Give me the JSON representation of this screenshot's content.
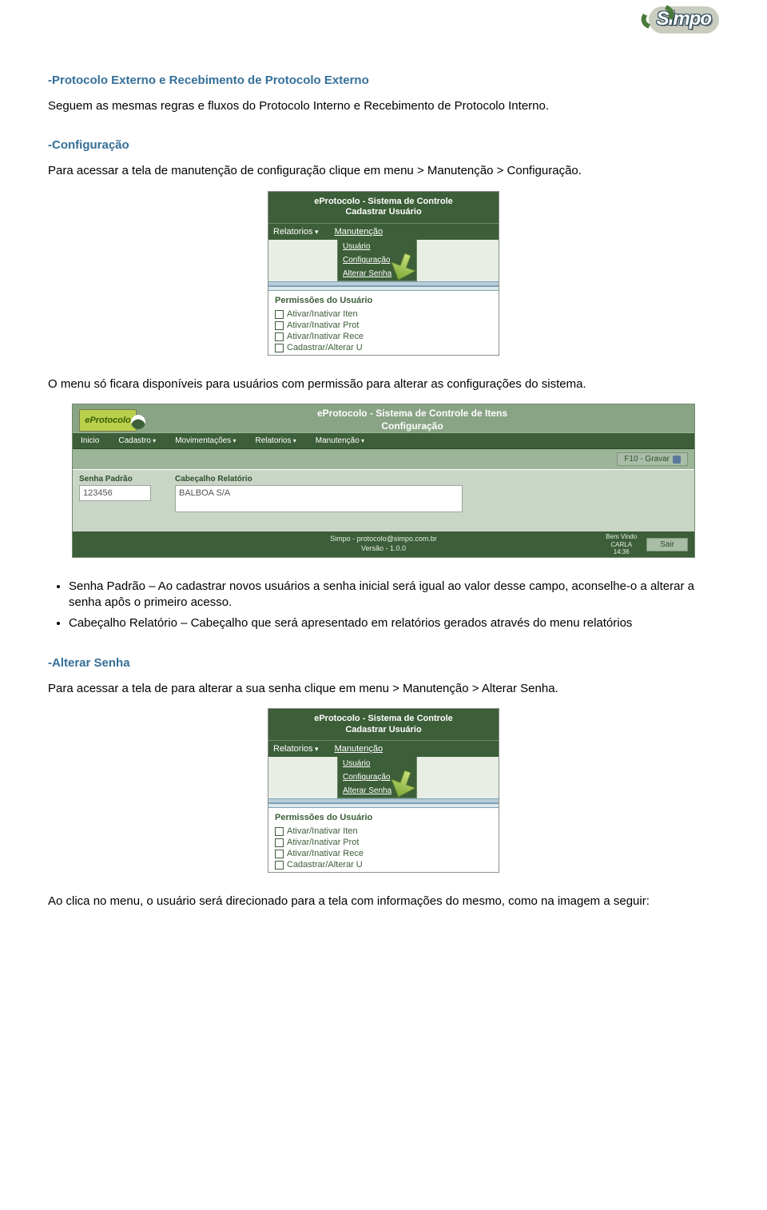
{
  "logo_text": "Simpo",
  "sections": {
    "s1_title": "-Protocolo Externo e Recebimento de Protocolo Externo",
    "s1_p1": "Seguem as mesmas regras e fluxos do Protocolo Interno e Recebimento de Protocolo Interno.",
    "s2_title": "-Configuração",
    "s2_p1": "Para acessar a tela de manutenção de configuração clique em menu > Manutenção > Configuração.",
    "s2_p2": "O menu só ficara disponíveis para usuários com permissão para alterar as configurações do sistema.",
    "bullets": {
      "b1": "Senha Padrão – Ao cadastrar novos usuários a senha inicial será igual ao valor desse campo, aconselhe-o a alterar a senha apôs o primeiro acesso.",
      "b2": "Cabeçalho Relatório – Cabeçalho que será apresentado em relatórios gerados através do menu relatórios"
    },
    "s3_title": "-Alterar Senha",
    "s3_p1": "Para acessar a tela de para alterar a sua senha clique em menu > Manutenção > Alterar Senha.",
    "s3_p2": "Ao clica no menu, o usuário será direcionado para a tela com informações do mesmo, como na imagem a seguir:"
  },
  "menu_shot": {
    "title_l1": "eProtocolo - Sistema de Controle",
    "title_l2": "Cadastrar Usuário",
    "nav_relatorios": "Relatorios",
    "nav_manut": "Manutenção",
    "dd_usuario": "Usuário",
    "dd_config": "Configuração",
    "dd_alterar": "Alterar Senha",
    "perm_title": "Permissões do Usuário",
    "perm1": "Ativar/Inativar Iten",
    "perm2": "Ativar/Inativar Prot",
    "perm3": "Ativar/Inativar Rece",
    "perm4": "Cadastrar/Alterar U"
  },
  "big_shot": {
    "eplogo": "eProtocolo",
    "title_l1": "eProtocolo - Sistema de Controle de Itens",
    "title_l2": "Configuração",
    "nav": {
      "inicio": "Inicio",
      "cadastro": "Cadastro",
      "mov": "Movimentações",
      "rel": "Relatorios",
      "manut": "Manutenção"
    },
    "btn_gravar": "F10 - Gravar",
    "field_senha_label": "Senha Padrão",
    "field_senha_value": "123456",
    "field_cab_label": "Cabeçalho Relatório",
    "field_cab_value": "BALBOA S/A",
    "footer_line1": "Simpo - protocolo@simpo.com.br",
    "footer_line2": "Versão - 1.0.0",
    "welcome_l1": "Bem Vindo",
    "welcome_l2": "CARLA",
    "welcome_l3": "14:36",
    "exit": "Sair"
  }
}
